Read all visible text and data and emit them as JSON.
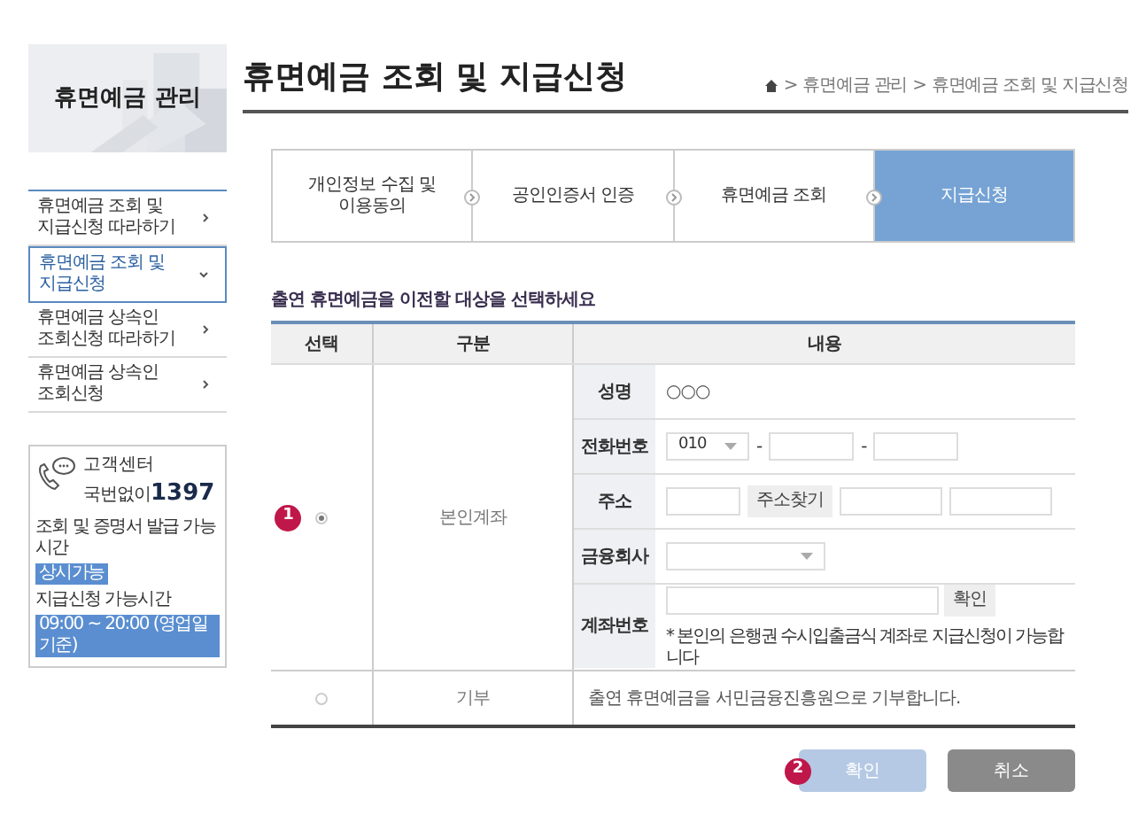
{
  "sidebar": {
    "title": "휴면예금 관리",
    "menu": [
      {
        "label": "휴면예금 조회 및\n지급신청 따라하기",
        "selected": false,
        "expanded": false
      },
      {
        "label": "휴면예금 조회 및\n지급신청",
        "selected": true,
        "expanded": true
      },
      {
        "label": "휴면예금 상속인\n조회신청 따라하기",
        "selected": false,
        "expanded": false
      },
      {
        "label": "휴면예금 상속인\n조회신청",
        "selected": false,
        "expanded": false
      }
    ],
    "contact": {
      "label": "고객센터",
      "prefix": "국번없이",
      "number": "1397",
      "hours": [
        {
          "label": "조회 및 증명서 발급 가능시간",
          "value": "상시가능"
        },
        {
          "label": "지급신청 가능시간",
          "value": "09:00 ~ 20:00 (영업일 기준)"
        }
      ]
    }
  },
  "page_title": "휴면예금 조회 및 지급신청",
  "breadcrumb": {
    "separator": ">",
    "items": [
      "휴면예금 관리",
      "휴면예금 조회 및 지급신청"
    ]
  },
  "steps": [
    {
      "label": "개인정보 수집 및\n이용동의",
      "selected": false
    },
    {
      "label": "공인인증서 인증",
      "selected": false
    },
    {
      "label": "휴면예금 조회",
      "selected": false
    },
    {
      "label": "지급신청",
      "selected": true
    }
  ],
  "section_title": "출연 휴면예금을 이전할 대상을 선택하세요",
  "table": {
    "columns": [
      "선택",
      "구분",
      "내용"
    ],
    "rows": [
      {
        "kind": "form",
        "selected": true,
        "badge": "1",
        "type": "본인계좌",
        "fields": [
          {
            "kind": "text",
            "label": "성명",
            "value": "○○○"
          },
          {
            "kind": "phone",
            "label": "전화번호",
            "value": "010",
            "separators": [
              "-",
              "-"
            ]
          },
          {
            "kind": "address",
            "label": "주소",
            "button": "주소찾기"
          },
          {
            "kind": "select",
            "label": "금융회사"
          },
          {
            "kind": "account",
            "label": "계좌번호",
            "button": "확인",
            "note": "* 본인의 은행권 수시입출금식 계좌로 지급신청이 가능합니다"
          }
        ]
      },
      {
        "kind": "text",
        "selected": false,
        "type": "기부",
        "text": "출연 휴면예금을 서민금융진흥원으로 기부합니다."
      }
    ]
  },
  "actions": {
    "badge": "2",
    "buttons": [
      {
        "label": "확인",
        "kind": "primary"
      },
      {
        "label": "취소",
        "kind": "secondary"
      }
    ]
  }
}
